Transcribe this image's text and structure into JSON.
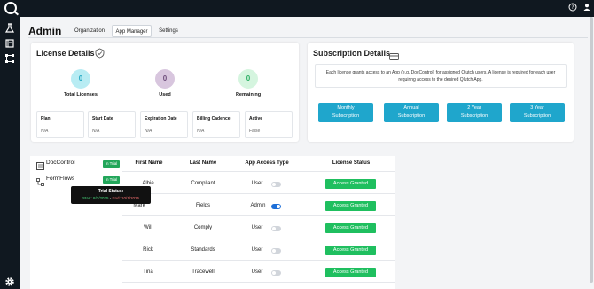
{
  "header": {
    "title": "Admin"
  },
  "tabs": [
    {
      "label": "Organization",
      "active": false
    },
    {
      "label": "App Manager",
      "active": true
    },
    {
      "label": "Settings",
      "active": false
    }
  ],
  "license": {
    "title": "License Details",
    "stats": [
      {
        "label": "Total Licenses",
        "value": "0",
        "bg": "#b8ecf3",
        "fg": "#24a9c4"
      },
      {
        "label": "Used",
        "value": "0",
        "bg": "#d8c6de",
        "fg": "#6e4d7c"
      },
      {
        "label": "Remaining",
        "value": "0",
        "bg": "#d5f5df",
        "fg": "#2bae63"
      }
    ],
    "info": [
      {
        "label": "Plan",
        "value": "N/A"
      },
      {
        "label": "Start Date",
        "value": "N/A"
      },
      {
        "label": "Expiration Date",
        "value": "N/A"
      },
      {
        "label": "Billing Cadence",
        "value": "N/A"
      },
      {
        "label": "Active",
        "value": "False"
      }
    ]
  },
  "subscription": {
    "title": "Subscription Details",
    "description": "Each license grants access to an App (e.g. DocControl) for assigned Qlutch users. A license is required for each user requiring access to the desired Qlutch App.",
    "buttons": [
      {
        "line1": "Monthly",
        "line2": "Subscription"
      },
      {
        "line1": "Annual",
        "line2": "Subscription"
      },
      {
        "line1": "2 Year",
        "line2": "Subscription"
      },
      {
        "line1": "3 Year",
        "line2": "Subscription"
      }
    ]
  },
  "apps": [
    {
      "name": "DocControl",
      "badge": "In Trial"
    },
    {
      "name": "FormFlows",
      "badge": "In Trial"
    }
  ],
  "tooltip": {
    "title": "Trial Status:",
    "start": "Start: 8/2/2025",
    "sep": "-",
    "end": "End: 10/1/2025"
  },
  "table": {
    "headers": [
      "First Name",
      "Last Name",
      "App Access Type",
      "License Status"
    ],
    "rows": [
      {
        "first": "Albie",
        "last": "Compliant",
        "access": "User",
        "admin": false,
        "status": "Access Granted"
      },
      {
        "first": "Mark",
        "last": "Fields",
        "access": "Admin",
        "admin": true,
        "status": "Access Granted"
      },
      {
        "first": "Will",
        "last": "Comply",
        "access": "User",
        "admin": false,
        "status": "Access Granted"
      },
      {
        "first": "Rick",
        "last": "Standards",
        "access": "User",
        "admin": false,
        "status": "Access Granted"
      },
      {
        "first": "Tina",
        "last": "Tracewell",
        "access": "User",
        "admin": false,
        "status": "Access Granted"
      }
    ]
  },
  "colors": {
    "accent": "#1fa6cc",
    "granted": "#1fbf5f",
    "trial": "#22a65a",
    "dark": "#101820"
  },
  "icons": [
    "logo-icon",
    "help-icon",
    "user-icon",
    "flask-icon",
    "library-icon",
    "workflow-icon",
    "settings-icon",
    "shield-check-icon",
    "credit-card-icon",
    "document-icon",
    "form-icon"
  ]
}
